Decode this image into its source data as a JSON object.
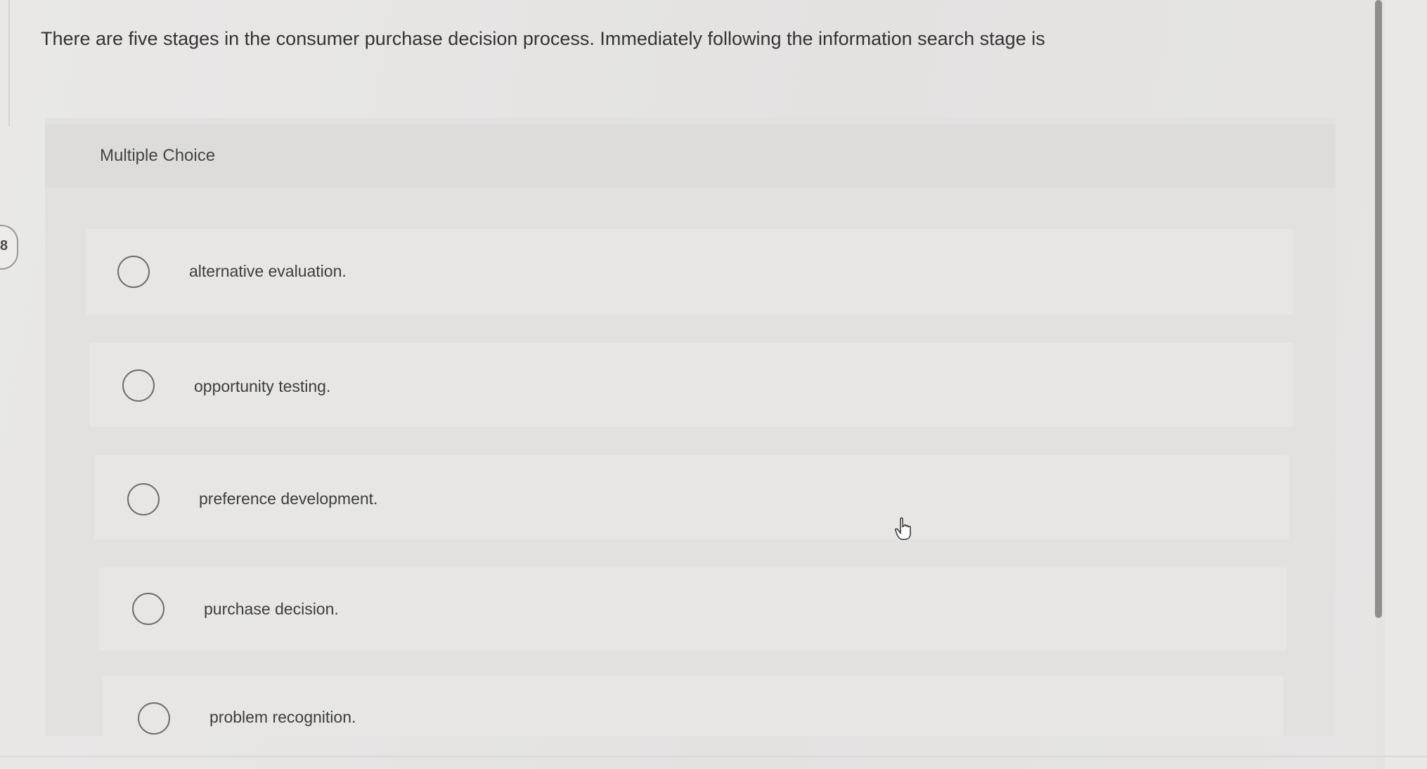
{
  "question": {
    "number": "8",
    "text": "There are five stages in the consumer purchase decision process. Immediately following the information search stage is"
  },
  "answer_area": {
    "type_label": "Multiple Choice",
    "choices": [
      {
        "label": "alternative evaluation."
      },
      {
        "label": "opportunity testing."
      },
      {
        "label": "preference development."
      },
      {
        "label": "purchase decision."
      },
      {
        "label": "problem recognition."
      }
    ]
  },
  "icons": {
    "cursor": "hand-pointer-icon",
    "radio": "radio-unchecked-icon"
  },
  "colors": {
    "background": "#e6e5e4",
    "panel": "#e2e1e0",
    "text": "#3a3a3a",
    "radio_border": "#6d6d6d"
  }
}
